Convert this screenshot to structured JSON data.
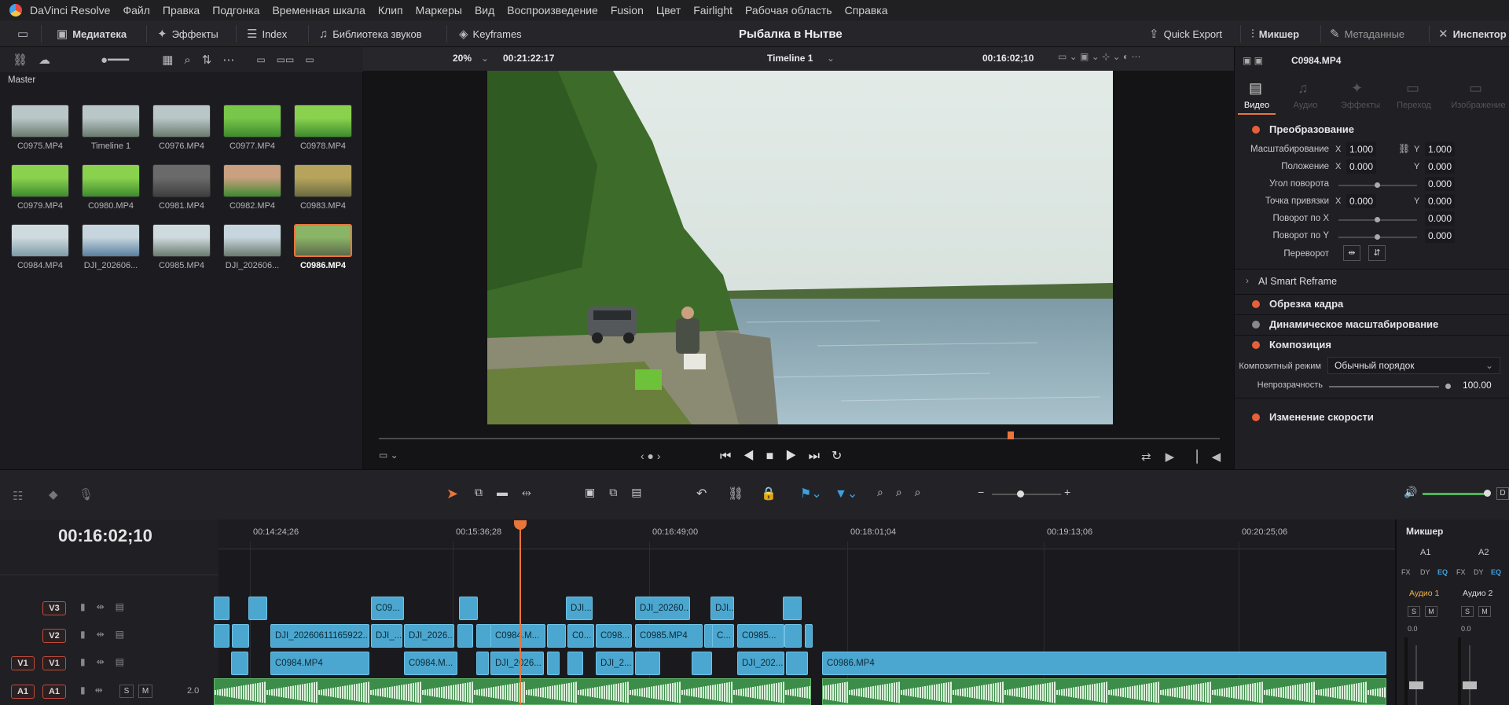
{
  "menu": {
    "app_name": "DaVinci Resolve",
    "items": [
      "Файл",
      "Правка",
      "Подгонка",
      "Временная шкала",
      "Клип",
      "Маркеры",
      "Вид",
      "Воспроизведение",
      "Fusion",
      "Цвет",
      "Fairlight",
      "Рабочая область",
      "Справка"
    ]
  },
  "toolbar": {
    "media_pool": "Медиатека",
    "effects": "Эффекты",
    "index": "Index",
    "sound_library": "Библиотека звуков",
    "keyframes": "Keyframes",
    "project_title": "Рыбалка в Нытве",
    "quick_export": "Quick Export",
    "mixer": "Микшер",
    "metadata": "Метаданные",
    "inspector": "Инспектор"
  },
  "media_pool": {
    "folder": "Master",
    "clips": [
      {
        "name": "C0975.MP4"
      },
      {
        "name": "Timeline 1"
      },
      {
        "name": "C0976.MP4"
      },
      {
        "name": "C0977.MP4"
      },
      {
        "name": "C0978.MP4"
      },
      {
        "name": "C0979.MP4"
      },
      {
        "name": "C0980.MP4"
      },
      {
        "name": "C0981.MP4"
      },
      {
        "name": "C0982.MP4"
      },
      {
        "name": "C0983.MP4"
      },
      {
        "name": "C0984.MP4"
      },
      {
        "name": "DJI_202606..."
      },
      {
        "name": "C0985.MP4"
      },
      {
        "name": "DJI_202606..."
      },
      {
        "name": "C0986.MP4"
      }
    ],
    "selected_index": 14
  },
  "viewer": {
    "zoom": "20%",
    "source_timecode": "00:21:22:17",
    "timeline_name": "Timeline 1",
    "timecode": "00:16:02;10"
  },
  "inspector": {
    "clip_name": "C0984.MP4",
    "tabs": [
      "Видео",
      "Аудио",
      "Эффекты",
      "Переход",
      "Изображение"
    ],
    "active_tab": "Видео",
    "transform_title": "Преобразование",
    "zoom_label": "Масштабирование",
    "zoom_x": "1.000",
    "zoom_y": "1.000",
    "position_label": "Положение",
    "position_x": "0.000",
    "position_y": "0.000",
    "rotation_label": "Угол поворота",
    "rotation_value": "0.000",
    "anchor_label": "Точка привязки",
    "anchor_x": "0.000",
    "anchor_y": "0.000",
    "pitch_label": "Поворот по X",
    "pitch_value": "0.000",
    "yaw_label": "Поворот по Y",
    "yaw_value": "0.000",
    "flip_label": "Переворот",
    "smart_reframe": "AI Smart Reframe",
    "cropping": "Обрезка кадра",
    "dynamic_zoom": "Динамическое масштабирование",
    "composite_title": "Композиция",
    "composite_mode_label": "Композитный режим",
    "composite_mode_value": "Обычный порядок",
    "opacity_label": "Непрозрачность",
    "opacity_value": "100.00",
    "speed_change": "Изменение скорости"
  },
  "timeline": {
    "timecode": "00:16:02;10",
    "ruler": [
      "00:14:24;26",
      "00:15:36;28",
      "00:16:49;00",
      "00:18:01;04",
      "00:19:13;06",
      "00:20:25;06"
    ],
    "tracks": {
      "v3": "V3",
      "v2": "V2",
      "v1_src": "V1",
      "v1": "V1",
      "a1_src": "A1",
      "a1": "A1",
      "a1_level": "2.0",
      "a1_solo": "S",
      "a1_mute": "M"
    },
    "v3_clips": [
      "",
      "",
      "C09...",
      "",
      "DJI...",
      "DJI_20260...",
      "DJI...",
      ""
    ],
    "v2_clips": [
      "",
      "",
      "DJI_20260611165922...",
      "DJI_...",
      "DJI_2026...",
      "",
      "",
      "C0984.M...",
      "",
      "C0...",
      "C098...",
      "C0985.MP4",
      "",
      "C...",
      "C0985...",
      "",
      ""
    ],
    "v1_clips": [
      "",
      "C0984.MP4",
      "C0984.M...",
      "",
      "DJI_2026...",
      "",
      "",
      "DJI_2...",
      "",
      "",
      "DJI_202...",
      "",
      "C0986.MP4"
    ]
  },
  "mixer": {
    "title": "Микшер",
    "ch1": "A1",
    "ch2": "A2",
    "ch1_name": "Аудио 1",
    "ch2_name": "Аудио 2",
    "fx": [
      "FX",
      "DY",
      "EQ",
      "FX",
      "DY",
      "EQ"
    ],
    "solo": "S",
    "mute": "M",
    "level1": "0.0",
    "level2": "0.0"
  }
}
